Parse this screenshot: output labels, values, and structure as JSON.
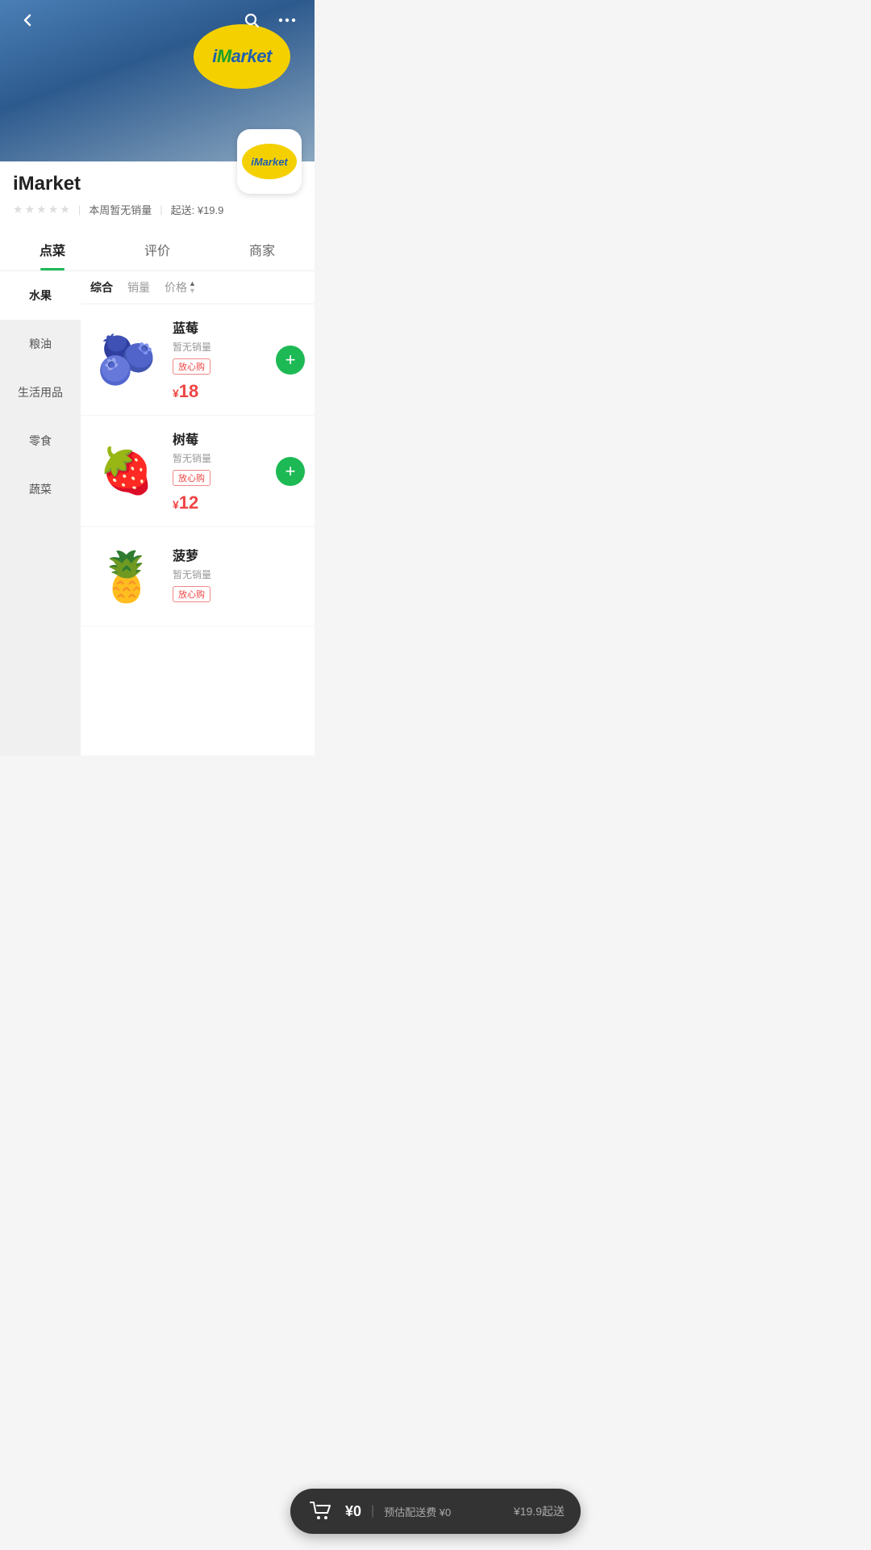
{
  "store": {
    "name": "iMarket",
    "logo_text": "iMarket",
    "stars": [
      false,
      false,
      false,
      false,
      false
    ],
    "sales_info": "本周暂无销量",
    "min_delivery": "起送: ¥19.9"
  },
  "tabs": [
    {
      "label": "点菜",
      "active": true
    },
    {
      "label": "评价",
      "active": false
    },
    {
      "label": "商家",
      "active": false
    }
  ],
  "sidebar_categories": [
    {
      "label": "水果",
      "active": true
    },
    {
      "label": "粮油",
      "active": false
    },
    {
      "label": "生活用品",
      "active": false
    },
    {
      "label": "零食",
      "active": false
    },
    {
      "label": "蔬菜",
      "active": false
    }
  ],
  "sort_options": [
    {
      "label": "综合",
      "active": true
    },
    {
      "label": "销量",
      "active": false
    },
    {
      "label": "价格",
      "active": false,
      "has_arrows": true
    }
  ],
  "products": [
    {
      "name": "蓝莓",
      "sales": "暂无销量",
      "tag": "放心购",
      "price": "18",
      "emoji": "🫐"
    },
    {
      "name": "树莓",
      "sales": "暂无销量",
      "tag": "放心购",
      "price": "12",
      "emoji": "🍓"
    },
    {
      "name": "菠萝",
      "sales": "暂无销量",
      "tag": "放心购",
      "price": "",
      "emoji": "🍍"
    }
  ],
  "cart": {
    "amount": "¥0",
    "fee_label": "预估配送费 ¥0",
    "min_label": "¥19.9起送"
  },
  "back_label": "‹",
  "search_label": "⌕",
  "more_label": "•••"
}
